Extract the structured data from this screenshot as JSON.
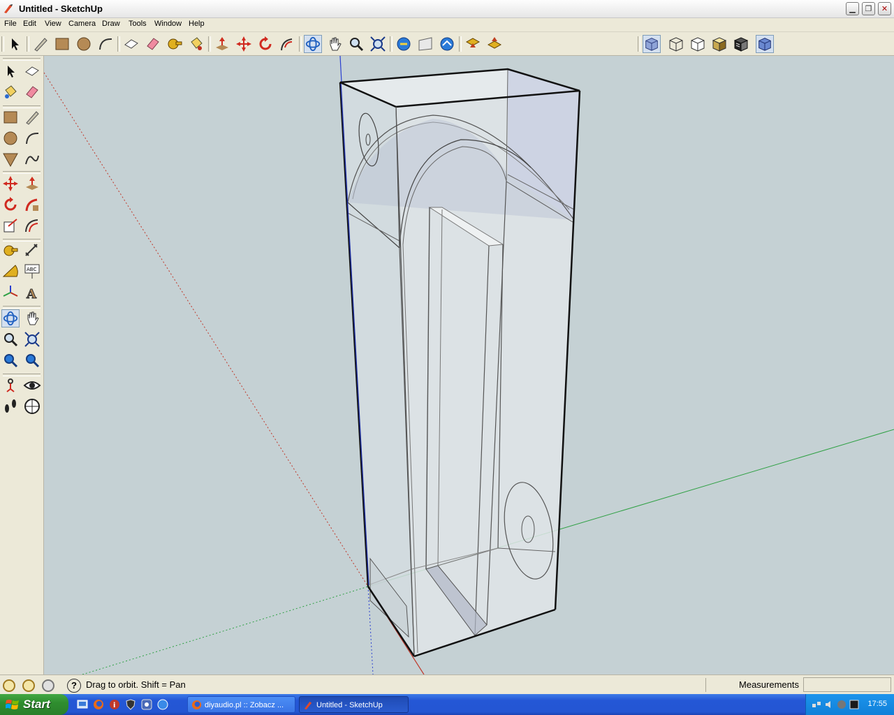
{
  "window": {
    "title": "Untitled - SketchUp",
    "buttons": [
      "minimize",
      "restore",
      "close"
    ]
  },
  "menu": {
    "items": [
      "File",
      "Edit",
      "View",
      "Camera",
      "Draw",
      "Tools",
      "Window",
      "Help"
    ]
  },
  "toolbar": {
    "active_tool": "orbit",
    "icons": [
      "select-icon",
      "pencil-line-icon",
      "rectangle-icon",
      "circle-icon",
      "arc-icon",
      "make-component-icon",
      "eraser-icon",
      "tape-measure-icon",
      "paint-bucket-icon",
      "push-pull-icon",
      "move-icon",
      "rotate-icon",
      "follow-me-icon",
      "orbit-icon",
      "pan-icon",
      "zoom-icon",
      "zoom-extents-icon",
      "previous-view-icon",
      "next-view-icon",
      "position-camera-icon",
      "get-models-icon",
      "share-model-icon"
    ],
    "view_styles": [
      "xray-style-icon",
      "wireframe-style-icon",
      "hidden-line-style-icon",
      "shaded-style-icon",
      "shaded-textures-style-icon",
      "monochrome-style-icon"
    ],
    "active_style": "xray"
  },
  "left_toolbar": {
    "active_tool": "orbit",
    "icons": [
      "select-icon",
      "make-component-icon",
      "paint-bucket-icon",
      "eraser-icon",
      "rectangle-icon",
      "line-icon",
      "circle-icon",
      "arc-icon",
      "polygon-icon",
      "freehand-icon",
      "move-icon",
      "push-pull-icon",
      "rotate-icon",
      "follow-me-icon",
      "scale-icon",
      "offset-icon",
      "tape-measure-icon",
      "dimension-icon",
      "protractor-icon",
      "text-icon",
      "axes-icon",
      "3d-text-icon",
      "orbit-icon",
      "pan-icon",
      "zoom-icon",
      "zoom-extents-icon",
      "previous-view-icon",
      "next-view-icon",
      "position-camera-icon",
      "look-around-icon",
      "walk-icon",
      "section-plane-icon"
    ]
  },
  "status": {
    "hint": "Drag to orbit.  Shift = Pan",
    "measurements_label": "Measurements",
    "measurements_value": ""
  },
  "taskbar": {
    "start_label": "Start",
    "tasks": [
      {
        "label": "diyaudio.pl :: Zobacz ...",
        "active": false
      },
      {
        "label": "Untitled - SketchUp",
        "active": true
      }
    ],
    "clock": "17:55"
  },
  "colors": {
    "viewport_bg": "#c5d1d4",
    "axis_red": "#c0392b",
    "axis_green": "#2ea043",
    "axis_blue": "#2a3fd0",
    "selection_blue": "#7f9db9"
  }
}
